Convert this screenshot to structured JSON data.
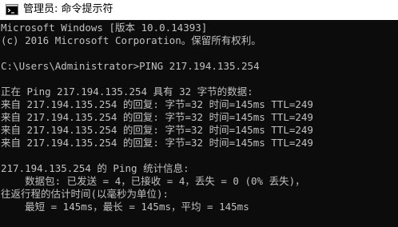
{
  "window": {
    "title": "管理员: 命令提示符",
    "icon": "cmd-icon"
  },
  "console": {
    "lines": [
      "Microsoft Windows [版本 10.0.14393]",
      "(c) 2016 Microsoft Corporation。保留所有权利。",
      "",
      "C:\\Users\\Administrator>PING 217.194.135.254",
      "",
      "正在 Ping 217.194.135.254 具有 32 字节的数据:",
      "来自 217.194.135.254 的回复: 字节=32 时间=145ms TTL=249",
      "来自 217.194.135.254 的回复: 字节=32 时间=145ms TTL=249",
      "来自 217.194.135.254 的回复: 字节=32 时间=145ms TTL=249",
      "来自 217.194.135.254 的回复: 字节=32 时间=145ms TTL=249",
      "",
      "217.194.135.254 的 Ping 统计信息:",
      "    数据包: 已发送 = 4，已接收 = 4，丢失 = 0 (0% 丢失)，",
      "往返行程的估计时间(以毫秒为单位):",
      "    最短 = 145ms，最长 = 145ms，平均 = 145ms"
    ]
  },
  "colors": {
    "console_bg": "#0c0c0c",
    "console_fg": "#c0c0c0",
    "titlebar_bg": "#ffffff"
  }
}
